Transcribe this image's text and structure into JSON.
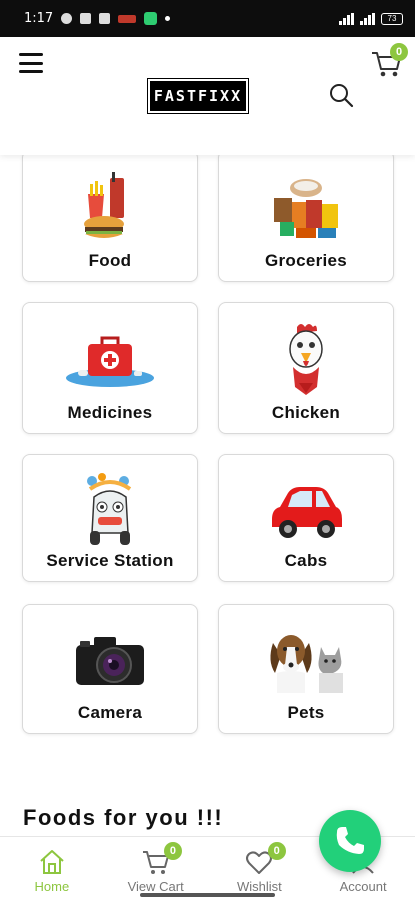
{
  "status_bar": {
    "time": "1:17",
    "battery": "73"
  },
  "header": {
    "logo_text": "FASTFIXX",
    "cart_count": "0",
    "accent_color": "#8dc63f"
  },
  "categories": [
    {
      "label": "Food",
      "icon": "food-icon"
    },
    {
      "label": "Groceries",
      "icon": "groceries-icon"
    },
    {
      "label": "Medicines",
      "icon": "medicines-icon"
    },
    {
      "label": "Chicken",
      "icon": "chicken-icon"
    },
    {
      "label": "Service Station",
      "icon": "service-station-icon"
    },
    {
      "label": "Cabs",
      "icon": "car-icon"
    },
    {
      "label": "Camera",
      "icon": "camera-icon"
    },
    {
      "label": "Pets",
      "icon": "pets-icon"
    }
  ],
  "section_title": "Foods for you !!!",
  "bottom_nav": {
    "home": "Home",
    "view_cart": "View Cart",
    "view_cart_count": "0",
    "wishlist": "Wishlist",
    "wishlist_count": "0",
    "account": "Account"
  },
  "fab_color": "#22d07a"
}
